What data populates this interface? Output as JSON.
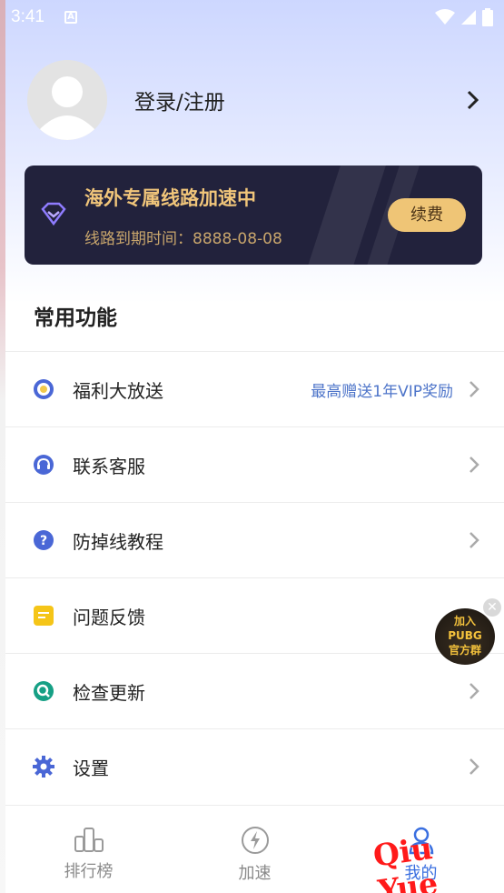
{
  "status_bar": {
    "time": "3:41",
    "notification_icon": "a-icon"
  },
  "profile": {
    "login_label": "登录/注册"
  },
  "vip_card": {
    "title": "海外专属线路加速中",
    "expiry": "线路到期时间：8888-08-08",
    "renew_label": "续费",
    "title_color": "#f0c57a",
    "button_color": "#efc576"
  },
  "section": {
    "title": "常用功能"
  },
  "menu": [
    {
      "label": "福利大放送",
      "extra": "最高赠送1年VIP奖励",
      "icon": "gift-wheel-icon"
    },
    {
      "label": "联系客服",
      "extra": "",
      "icon": "headset-icon"
    },
    {
      "label": "防掉线教程",
      "extra": "",
      "icon": "help-circle-icon"
    },
    {
      "label": "问题反馈",
      "extra": "",
      "icon": "note-icon"
    },
    {
      "label": "检查更新",
      "extra": "",
      "icon": "search-update-icon"
    },
    {
      "label": "设置",
      "extra": "",
      "icon": "gear-icon"
    }
  ],
  "float_badge": {
    "line1": "加入",
    "line2": "PUBG",
    "line3": "官方群"
  },
  "bottom_nav": [
    {
      "label": "排行榜",
      "icon": "ranking-icon"
    },
    {
      "label": "加速",
      "icon": "lightning-icon"
    },
    {
      "label": "我的",
      "icon": "profile-icon"
    }
  ],
  "watermark": "Qiu Yue",
  "accent_color": "#3a6fe0"
}
